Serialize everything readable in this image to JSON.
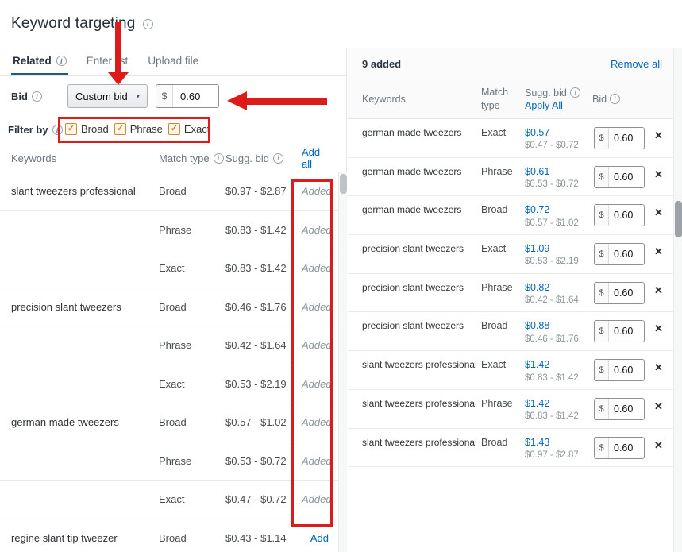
{
  "header": {
    "title": "Keyword targeting"
  },
  "icons": {
    "info": "i",
    "caret_down": "▾",
    "check": "✓",
    "close": "✕"
  },
  "colors": {
    "link_blue": "#0066c0",
    "annotation_red": "#de1b1b",
    "checkbox_orange": "#e47911",
    "tab_underline": "#1e5b87"
  },
  "tabs": {
    "related": "Related",
    "enter_list": "Enter list",
    "upload_file": "Upload file"
  },
  "bid_controls": {
    "label": "Bid",
    "dropdown_value": "Custom bid",
    "currency": "$",
    "bid_value": "0.60"
  },
  "filter": {
    "label": "Filter by",
    "options": [
      {
        "label": "Broad",
        "checked": true
      },
      {
        "label": "Phrase",
        "checked": true
      },
      {
        "label": "Exact",
        "checked": true
      }
    ]
  },
  "suggestions": {
    "headers": {
      "keywords": "Keywords",
      "match_type": "Match type",
      "sugg_bid": "Sugg. bid",
      "add_all": "Add all"
    },
    "rows": [
      {
        "keyword": "slant tweezers professional",
        "match_type": "Broad",
        "sugg_bid": "$0.97 - $2.87",
        "action": "Added",
        "added": true
      },
      {
        "keyword": "",
        "match_type": "Phrase",
        "sugg_bid": "$0.83 - $1.42",
        "action": "Added",
        "added": true
      },
      {
        "keyword": "",
        "match_type": "Exact",
        "sugg_bid": "$0.83 - $1.42",
        "action": "Added",
        "added": true
      },
      {
        "keyword": "precision slant tweezers",
        "match_type": "Broad",
        "sugg_bid": "$0.46 - $1.76",
        "action": "Added",
        "added": true
      },
      {
        "keyword": "",
        "match_type": "Phrase",
        "sugg_bid": "$0.42 - $1.64",
        "action": "Added",
        "added": true
      },
      {
        "keyword": "",
        "match_type": "Exact",
        "sugg_bid": "$0.53 - $2.19",
        "action": "Added",
        "added": true
      },
      {
        "keyword": "german made tweezers",
        "match_type": "Broad",
        "sugg_bid": "$0.57 - $1.02",
        "action": "Added",
        "added": true
      },
      {
        "keyword": "",
        "match_type": "Phrase",
        "sugg_bid": "$0.53 - $0.72",
        "action": "Added",
        "added": true
      },
      {
        "keyword": "",
        "match_type": "Exact",
        "sugg_bid": "$0.47 - $0.72",
        "action": "Added",
        "added": true
      },
      {
        "keyword": "regine slant tip tweezer",
        "match_type": "Broad",
        "sugg_bid": "$0.43 - $1.14",
        "action": "Add",
        "added": false
      }
    ]
  },
  "added_panel": {
    "count_label": "9 added",
    "remove_all": "Remove all",
    "currency": "$",
    "headers": {
      "keywords": "Keywords",
      "match_type": "Match type",
      "sugg_bid": "Sugg. bid",
      "apply_all": "Apply All",
      "bid": "Bid"
    },
    "rows": [
      {
        "keyword": "german made tweezers",
        "match_type": "Exact",
        "sugg_bid": "$0.57",
        "bid_range": "$0.47 - $0.72",
        "bid": "0.60"
      },
      {
        "keyword": "german made tweezers",
        "match_type": "Phrase",
        "sugg_bid": "$0.61",
        "bid_range": "$0.53 - $0.72",
        "bid": "0.60"
      },
      {
        "keyword": "german made tweezers",
        "match_type": "Broad",
        "sugg_bid": "$0.72",
        "bid_range": "$0.57 - $1.02",
        "bid": "0.60"
      },
      {
        "keyword": "precision slant tweezers",
        "match_type": "Exact",
        "sugg_bid": "$1.09",
        "bid_range": "$0.53 - $2.19",
        "bid": "0.60"
      },
      {
        "keyword": "precision slant tweezers",
        "match_type": "Phrase",
        "sugg_bid": "$0.82",
        "bid_range": "$0.42 - $1.64",
        "bid": "0.60"
      },
      {
        "keyword": "precision slant tweezers",
        "match_type": "Broad",
        "sugg_bid": "$0.88",
        "bid_range": "$0.46 - $1.76",
        "bid": "0.60"
      },
      {
        "keyword": "slant tweezers professional",
        "match_type": "Exact",
        "sugg_bid": "$1.42",
        "bid_range": "$0.83 - $1.42",
        "bid": "0.60"
      },
      {
        "keyword": "slant tweezers professional",
        "match_type": "Phrase",
        "sugg_bid": "$1.42",
        "bid_range": "$0.83 - $1.42",
        "bid": "0.60"
      },
      {
        "keyword": "slant tweezers professional",
        "match_type": "Broad",
        "sugg_bid": "$1.43",
        "bid_range": "$0.97 - $2.87",
        "bid": "0.60"
      }
    ]
  }
}
